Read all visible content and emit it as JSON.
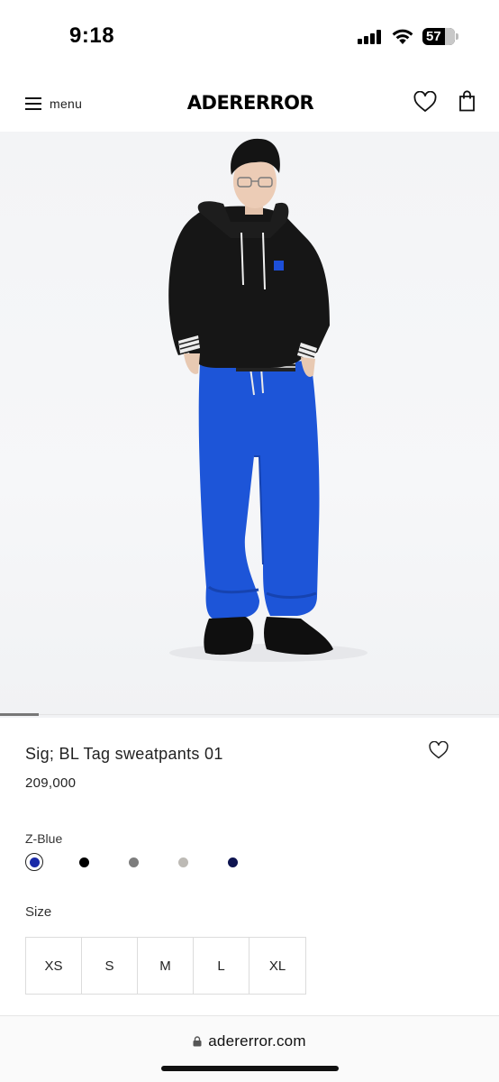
{
  "status_bar": {
    "time": "9:18",
    "battery": "57"
  },
  "header": {
    "menu_label": "menu",
    "logo": "ADERERROR"
  },
  "product": {
    "title": "Sig; BL Tag sweatpants 01",
    "price": "209,000",
    "color_name": "Z-Blue",
    "colors": [
      {
        "name": "Z-Blue",
        "hex": "#1a2aa8",
        "selected": true
      },
      {
        "name": "black",
        "hex": "#000000",
        "selected": false
      },
      {
        "name": "grey",
        "hex": "#7d7d7d",
        "selected": false
      },
      {
        "name": "light grey",
        "hex": "#bdbab5",
        "selected": false
      },
      {
        "name": "navy",
        "hex": "#0e1450",
        "selected": false
      }
    ],
    "size_label": "Size",
    "sizes": [
      "XS",
      "S",
      "M",
      "L",
      "XL"
    ]
  },
  "browser": {
    "url": "adererror.com"
  },
  "icons": {
    "menu": "hamburger-icon",
    "wishlist": "heart-icon",
    "bag": "shopping-bag-icon",
    "lock": "lock-icon"
  },
  "colors": {
    "pants_blue": "#1d55d8",
    "hoodie": "#161616",
    "background": "#f4f5f7"
  }
}
